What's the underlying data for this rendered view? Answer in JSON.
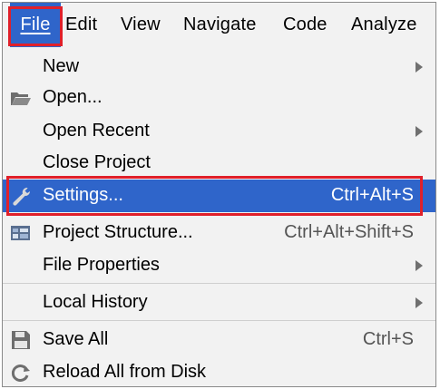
{
  "menubar": {
    "file": "File",
    "edit": "Edit",
    "view": "View",
    "navigate": "Navigate",
    "code": "Code",
    "analyze": "Analyze"
  },
  "file_menu": {
    "new": "New",
    "open": "Open...",
    "open_recent": "Open Recent",
    "close_project": "Close Project",
    "settings": "Settings...",
    "settings_shortcut": "Ctrl+Alt+S",
    "project_structure": "Project Structure...",
    "project_structure_shortcut": "Ctrl+Alt+Shift+S",
    "file_properties": "File Properties",
    "local_history": "Local History",
    "save_all": "Save All",
    "save_all_shortcut": "Ctrl+S",
    "reload_all": "Reload All from Disk"
  },
  "colors": {
    "selection": "#2f65ca",
    "highlight_outline": "#e0202a",
    "menu_bg": "#f2f2f2"
  }
}
